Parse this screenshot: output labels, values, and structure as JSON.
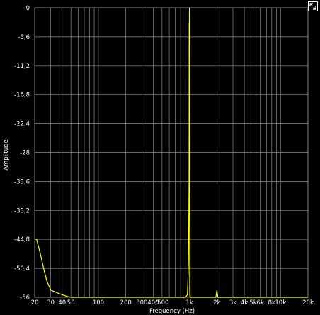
{
  "chart_data": {
    "type": "line",
    "xlabel": "Frequency (Hz)",
    "ylabel": "Amplitude",
    "xscale": "log",
    "xlim": [
      20,
      20000
    ],
    "ylim": [
      -56,
      0
    ],
    "grid": true,
    "y_ticks": [
      {
        "value": 0,
        "label": "0"
      },
      {
        "value": -5.6,
        "label": "-5,6"
      },
      {
        "value": -11.2,
        "label": "-11,2"
      },
      {
        "value": -16.8,
        "label": "-16,8"
      },
      {
        "value": -22.4,
        "label": "-22,4"
      },
      {
        "value": -28,
        "label": "-28"
      },
      {
        "value": -33.6,
        "label": "-33,6"
      },
      {
        "value": -39.2,
        "label": "-33,2"
      },
      {
        "value": -44.8,
        "label": "-44,8"
      },
      {
        "value": -50.4,
        "label": "-50,4"
      },
      {
        "value": -56,
        "label": "-56"
      }
    ],
    "x_ticks": [
      {
        "value": 20,
        "label": "20"
      },
      {
        "value": 30,
        "label": "30"
      },
      {
        "value": 40,
        "label": "40"
      },
      {
        "value": 50,
        "label": "50"
      },
      {
        "value": 100,
        "label": "100"
      },
      {
        "value": 200,
        "label": "200"
      },
      {
        "value": 300,
        "label": "300"
      },
      {
        "value": 400,
        "label": "400"
      },
      {
        "value": 500,
        "label": "/500"
      },
      {
        "value": 1000,
        "label": "1k"
      },
      {
        "value": 2000,
        "label": "2k"
      },
      {
        "value": 3000,
        "label": "3k"
      },
      {
        "value": 4000,
        "label": "4k"
      },
      {
        "value": 5000,
        "label": "5k"
      },
      {
        "value": 6000,
        "label": "6k"
      },
      {
        "value": 8000,
        "label": "8k"
      },
      {
        "value": 10000,
        "label": "10k"
      },
      {
        "value": 20000,
        "label": "20k"
      }
    ],
    "x_minor_gridlines": [
      60,
      70,
      80,
      90,
      600,
      700,
      800,
      900,
      7000,
      9000
    ],
    "series": [
      {
        "color": "#ffff00",
        "points": [
          [
            20,
            -44.8
          ],
          [
            21,
            -44.8
          ],
          [
            23,
            -47.5
          ],
          [
            25,
            -50.3
          ],
          [
            27,
            -52.7
          ],
          [
            30,
            -54.6
          ],
          [
            35,
            -55.1
          ],
          [
            40,
            -55.5
          ],
          [
            45,
            -55.8
          ],
          [
            50,
            -56
          ],
          [
            100,
            -56
          ],
          [
            500,
            -56
          ],
          [
            900,
            -56
          ],
          [
            950,
            -55.5
          ],
          [
            975,
            -49.3
          ],
          [
            985,
            -39.2
          ],
          [
            990,
            -33.6
          ],
          [
            993,
            -3.0
          ],
          [
            995,
            -2.8
          ],
          [
            997,
            -3.3
          ],
          [
            999,
            -0.3
          ],
          [
            1000,
            0
          ],
          [
            1001,
            -0.4
          ],
          [
            1003,
            -3.1
          ],
          [
            1006,
            -39.2
          ],
          [
            1010,
            -54.6
          ],
          [
            1020,
            -56
          ],
          [
            1950,
            -56
          ],
          [
            2000,
            -54.6
          ],
          [
            2050,
            -56
          ],
          [
            20000,
            -56
          ]
        ]
      }
    ]
  },
  "controls": {
    "expand_icon": "expand-corner-icon"
  }
}
